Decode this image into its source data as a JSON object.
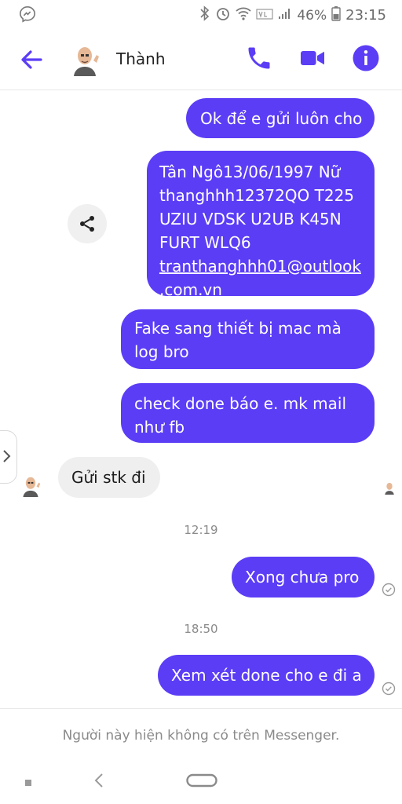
{
  "status": {
    "battery": "46%",
    "time": "23:15"
  },
  "header": {
    "contact_name": "Thành"
  },
  "messages": [
    {
      "text": "Ok để e gửi luôn cho"
    },
    {
      "lines": [
        "Tân Ngô13/06/1997 Nữ",
        "thanghhh12372QO T225",
        "UZIU VDSK U2UB K45N",
        "FURT WLQ6"
      ],
      "link_line1": "tranthanghhh01@outlook",
      "link_line2": ".com.vn"
    },
    {
      "line1": "Fake sang thiết bị mac mà",
      "line2": "log bro"
    },
    {
      "line1": "check done báo e. mk mail",
      "line2": "như fb"
    },
    {
      "text": "Gửi stk đi"
    },
    {
      "text": "Xong chưa pro"
    },
    {
      "text": "Xem xét done cho e đi a"
    }
  ],
  "timestamps": [
    "12:19",
    "18:50"
  ],
  "footer": {
    "notice": "Người này hiện không có trên Messenger."
  },
  "colors": {
    "accent": "#5b3df6",
    "incoming_bubble": "#efefef"
  }
}
